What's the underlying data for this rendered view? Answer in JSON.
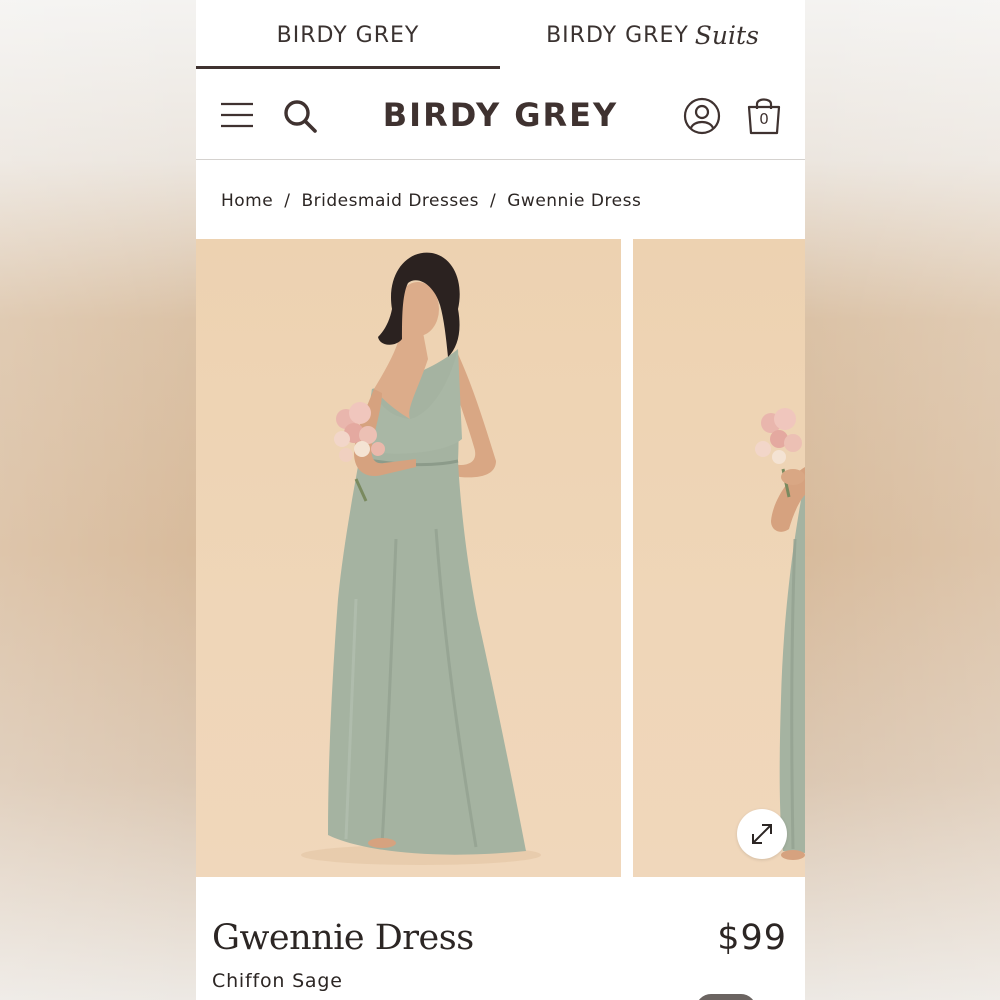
{
  "brand_tabs": [
    {
      "label": "BIRDY GREY",
      "active": true
    },
    {
      "label": "BIRDY GREY",
      "suffix": "Suits",
      "active": false
    }
  ],
  "header": {
    "logo": "BIRDY GREY",
    "bag_count": "0",
    "icons": [
      "menu-icon",
      "search-icon",
      "account-icon",
      "bag-icon"
    ]
  },
  "breadcrumb": {
    "items": [
      "Home",
      "Bridesmaid Dresses",
      "Gwennie Dress"
    ],
    "separator": "/"
  },
  "gallery": {
    "background_color": "#efd4b5",
    "dress_color": "#a5b3a1",
    "expand_icon": "expand-arrows-icon"
  },
  "product": {
    "name": "Gwennie Dress",
    "price": "$99",
    "variant": "Chiffon Sage"
  },
  "colors": {
    "text": "#2c2624",
    "brand": "#3f3230"
  }
}
